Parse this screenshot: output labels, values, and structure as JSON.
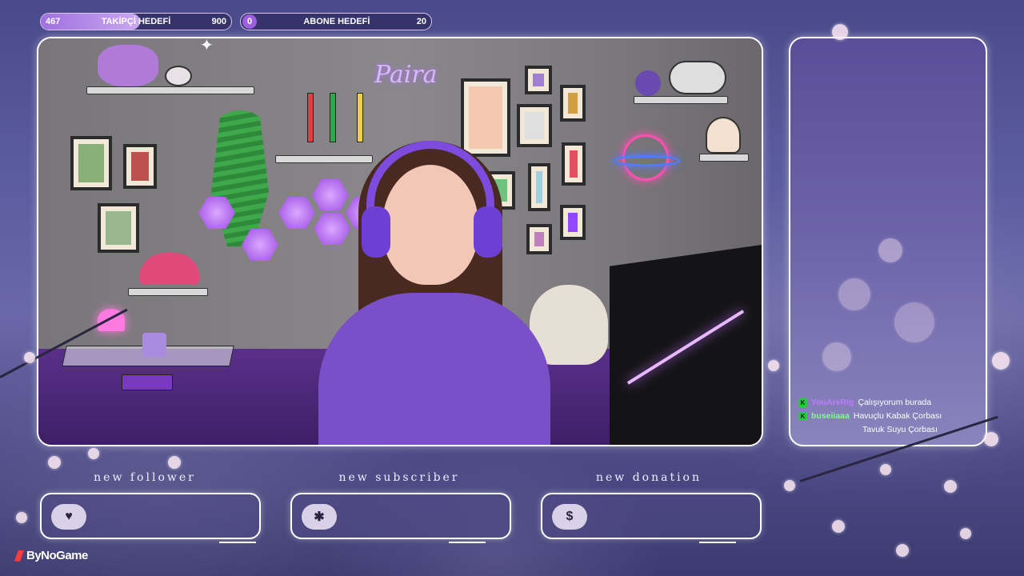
{
  "goals": {
    "follower": {
      "current": "467",
      "label": "TAKİPÇİ HEDEFİ",
      "target": "900",
      "progress": 0.519
    },
    "subscriber": {
      "current": "0",
      "label": "ABONE HEDEFİ",
      "target": "20",
      "progress": 0.0
    }
  },
  "camera": {
    "neon_sign": "Paira"
  },
  "chat": {
    "messages": [
      {
        "user": "YouAreRig",
        "user_color": "#c17bff",
        "text": "Çalışıyorum burada"
      },
      {
        "user": "buseiiaaa",
        "user_color": "#7dff8a",
        "text": "Havuçlu Kabak Çorbası"
      },
      {
        "user": "",
        "user_color": "#ffffff",
        "text": "Tavuk Suyu Çorbası"
      }
    ],
    "badge_label": "K"
  },
  "alerts": [
    {
      "title": "new follower",
      "icon": "heart-icon",
      "glyph": "♥"
    },
    {
      "title": "new subscriber",
      "icon": "star-icon",
      "glyph": "✱"
    },
    {
      "title": "new donation",
      "icon": "dollar-icon",
      "glyph": "$"
    }
  ],
  "brand": {
    "name": "ByNoGame"
  },
  "colors": {
    "accent": "#a070e0",
    "frame": "#ffffff",
    "background": "#5b5ba0"
  }
}
